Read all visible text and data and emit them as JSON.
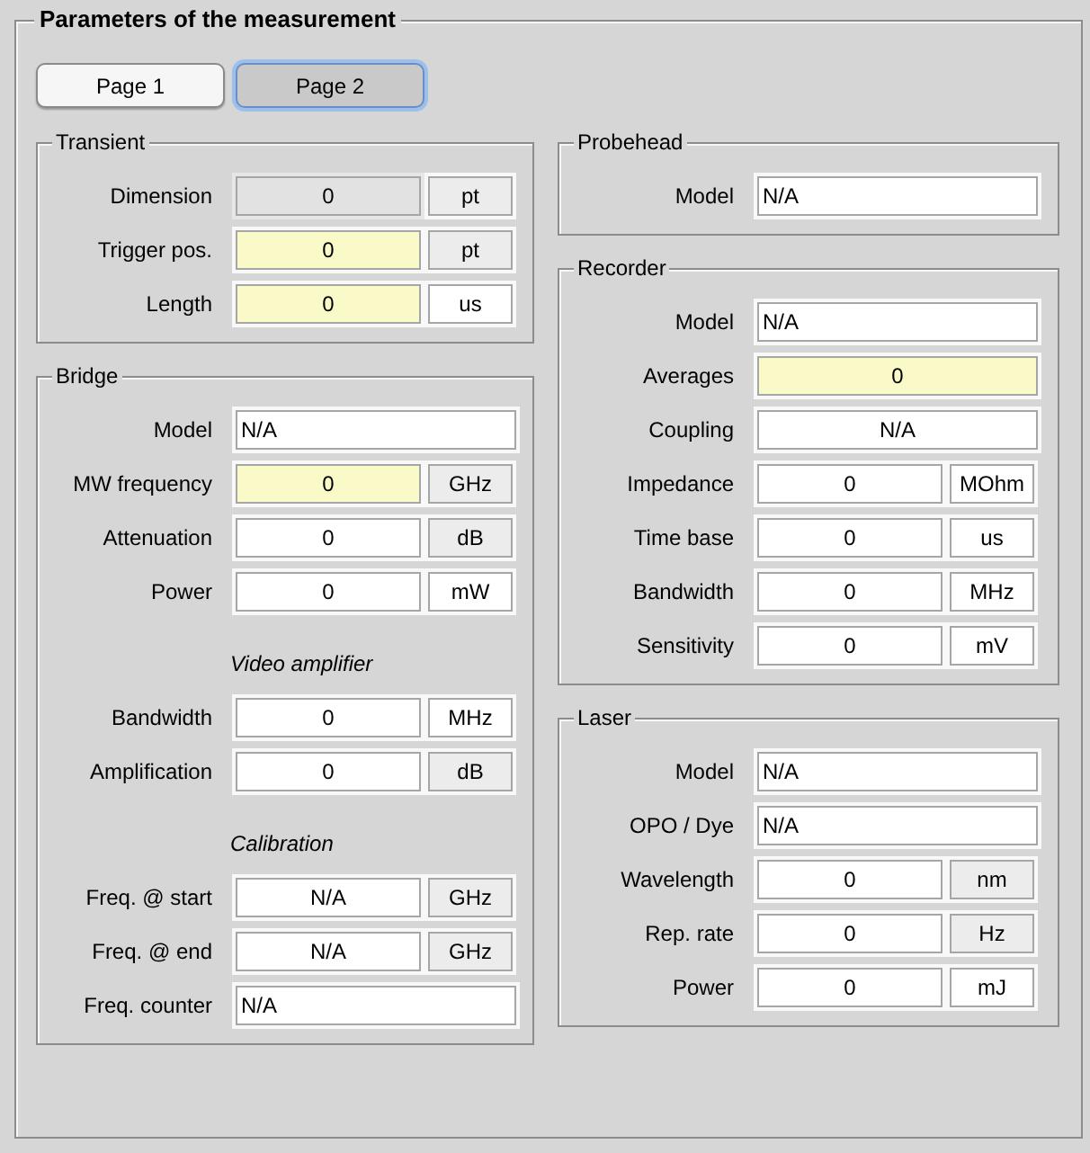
{
  "window": {
    "title": "Parameters of the measurement"
  },
  "tabs": [
    {
      "label": "Page 1",
      "selected": false
    },
    {
      "label": "Page 2",
      "selected": true
    }
  ],
  "left_column": [
    {
      "title": "Transient",
      "rows": [
        {
          "kind": "numeric",
          "label": "Dimension",
          "value": "0",
          "editable": false,
          "highlighted": false,
          "unit": "pt",
          "unit_editable": false
        },
        {
          "kind": "numeric",
          "label": "Trigger pos.",
          "value": "0",
          "editable": true,
          "highlighted": true,
          "unit": "pt",
          "unit_editable": false
        },
        {
          "kind": "numeric",
          "label": "Length",
          "value": "0",
          "editable": true,
          "highlighted": true,
          "unit": "us",
          "unit_editable": true
        }
      ]
    },
    {
      "title": "Bridge",
      "rows": [
        {
          "kind": "text",
          "label": "Model",
          "value": "N/A",
          "editable": true,
          "highlighted": false
        },
        {
          "kind": "numeric",
          "label": "MW frequency",
          "value": "0",
          "editable": true,
          "highlighted": true,
          "unit": "GHz",
          "unit_editable": false
        },
        {
          "kind": "numeric",
          "label": "Attenuation",
          "value": "0",
          "editable": true,
          "highlighted": false,
          "unit": "dB",
          "unit_editable": false
        },
        {
          "kind": "numeric",
          "label": "Power",
          "value": "0",
          "editable": true,
          "highlighted": false,
          "unit": "mW",
          "unit_editable": true
        },
        {
          "kind": "subheading",
          "label": "Video amplifier"
        },
        {
          "kind": "numeric",
          "label": "Bandwidth",
          "value": "0",
          "editable": true,
          "highlighted": false,
          "unit": "MHz",
          "unit_editable": true
        },
        {
          "kind": "numeric",
          "label": "Amplification",
          "value": "0",
          "editable": true,
          "highlighted": false,
          "unit": "dB",
          "unit_editable": false
        },
        {
          "kind": "subheading",
          "label": "Calibration"
        },
        {
          "kind": "numeric",
          "label": "Freq. @ start",
          "value": "N/A",
          "editable": true,
          "highlighted": false,
          "unit": "GHz",
          "unit_editable": false
        },
        {
          "kind": "numeric",
          "label": "Freq. @ end",
          "value": "N/A",
          "editable": true,
          "highlighted": false,
          "unit": "GHz",
          "unit_editable": false
        },
        {
          "kind": "text",
          "label": "Freq. counter",
          "value": "N/A",
          "editable": true,
          "highlighted": false
        }
      ]
    }
  ],
  "right_column": [
    {
      "title": "Probehead",
      "rows": [
        {
          "kind": "text",
          "label": "Model",
          "value": "N/A",
          "editable": true,
          "highlighted": false
        }
      ]
    },
    {
      "title": "Recorder",
      "rows": [
        {
          "kind": "text",
          "label": "Model",
          "value": "N/A",
          "editable": true,
          "highlighted": false
        },
        {
          "kind": "centered",
          "label": "Averages",
          "value": "0",
          "editable": true,
          "highlighted": true
        },
        {
          "kind": "centered",
          "label": "Coupling",
          "value": "N/A",
          "editable": true,
          "highlighted": false
        },
        {
          "kind": "numeric",
          "label": "Impedance",
          "value": "0",
          "editable": true,
          "highlighted": false,
          "unit": "MOhm",
          "unit_editable": true
        },
        {
          "kind": "numeric",
          "label": "Time base",
          "value": "0",
          "editable": true,
          "highlighted": false,
          "unit": "us",
          "unit_editable": true
        },
        {
          "kind": "numeric",
          "label": "Bandwidth",
          "value": "0",
          "editable": true,
          "highlighted": false,
          "unit": "MHz",
          "unit_editable": true
        },
        {
          "kind": "numeric",
          "label": "Sensitivity",
          "value": "0",
          "editable": true,
          "highlighted": false,
          "unit": "mV",
          "unit_editable": true
        }
      ]
    },
    {
      "title": "Laser",
      "rows": [
        {
          "kind": "text",
          "label": "Model",
          "value": "N/A",
          "editable": true,
          "highlighted": false
        },
        {
          "kind": "text",
          "label": "OPO / Dye",
          "value": "N/A",
          "editable": true,
          "highlighted": false
        },
        {
          "kind": "numeric",
          "label": "Wavelength",
          "value": "0",
          "editable": true,
          "highlighted": false,
          "unit": "nm",
          "unit_editable": false
        },
        {
          "kind": "numeric",
          "label": "Rep. rate",
          "value": "0",
          "editable": true,
          "highlighted": false,
          "unit": "Hz",
          "unit_editable": false
        },
        {
          "kind": "numeric",
          "label": "Power",
          "value": "0",
          "editable": true,
          "highlighted": false,
          "unit": "mJ",
          "unit_editable": true
        }
      ]
    }
  ]
}
